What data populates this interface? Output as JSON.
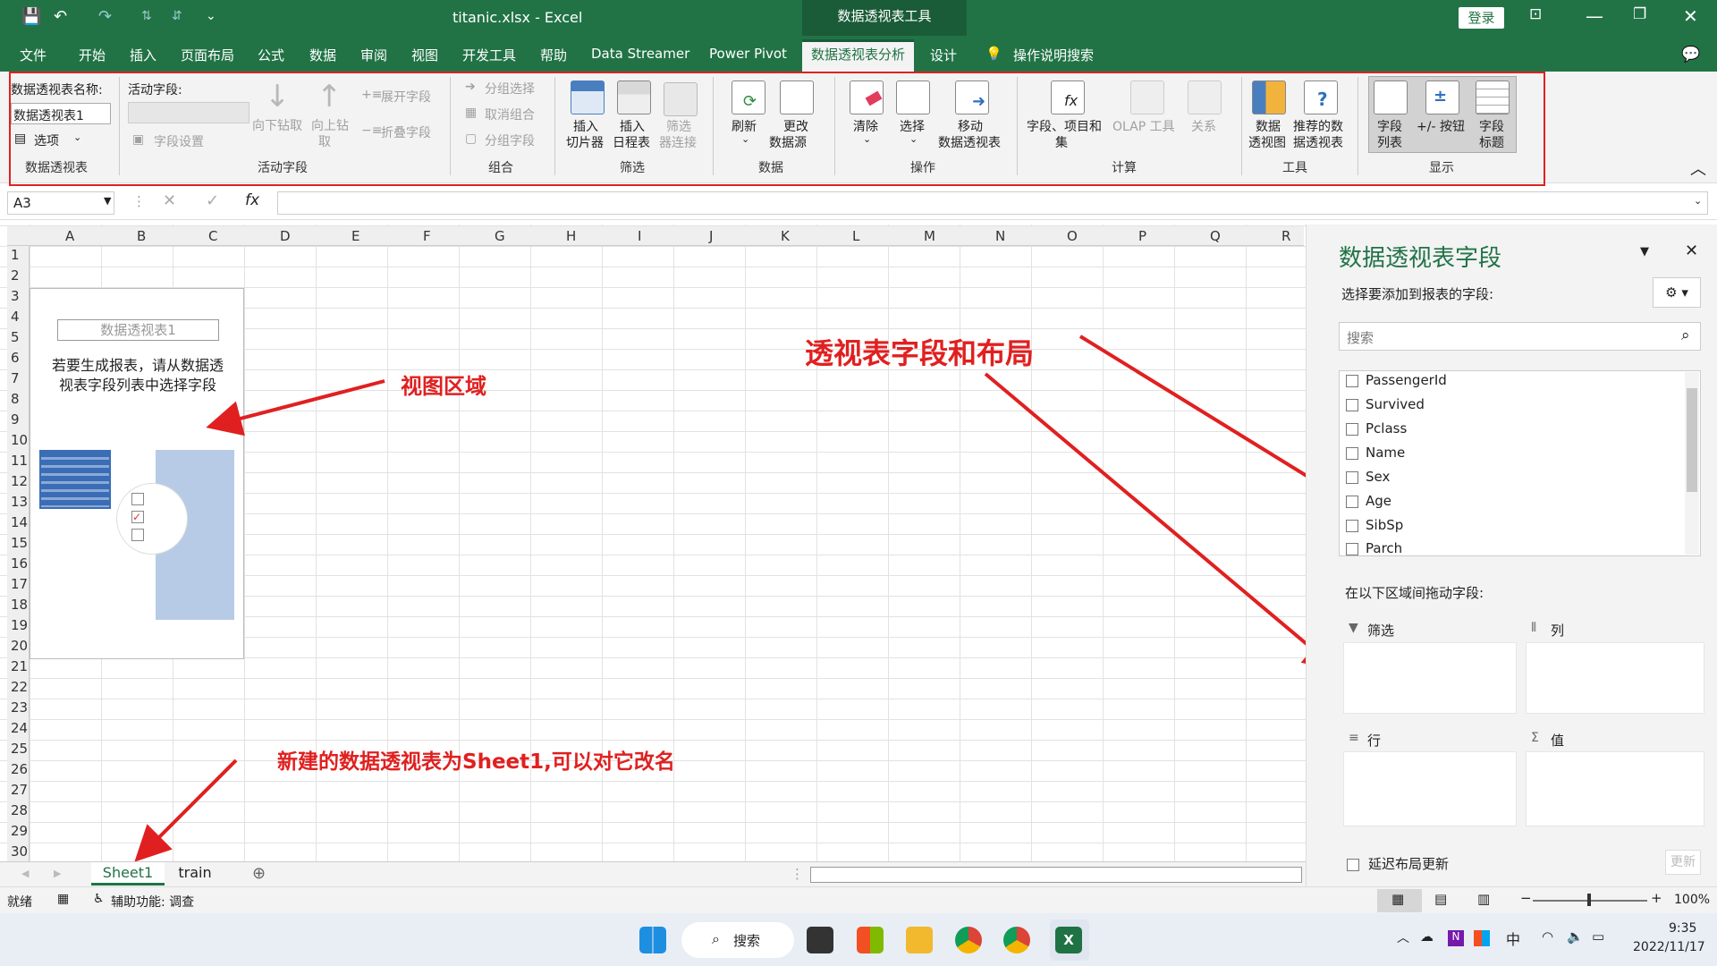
{
  "titlebar": {
    "file_title": "titanic.xlsx  -  Excel",
    "context_title": "数据透视表工具",
    "login": "登录",
    "qa_save": "💾",
    "qa_undo": "↶",
    "qa_redo": "↷"
  },
  "tabs": [
    "文件",
    "开始",
    "插入",
    "页面布局",
    "公式",
    "数据",
    "审阅",
    "视图",
    "开发工具",
    "帮助",
    "Data Streamer",
    "Power Pivot",
    "数据透视表分析",
    "设计"
  ],
  "tell_me": "操作说明搜索",
  "ribbon": {
    "pivot_name_label": "数据透视表名称:",
    "pivot_name_value": "数据透视表1",
    "options": "选项",
    "group_pivot": "数据透视表",
    "active_field_label": "活动字段:",
    "field_settings": "字段设置",
    "drill_down": "向下钻取",
    "drill_up": "向上钻",
    "drill_up2": "取",
    "expand_field": "展开字段",
    "collapse_field": "折叠字段",
    "group_active": "活动字段",
    "group_select": "分组选择",
    "ungroup": "取消组合",
    "group_field": "分组字段",
    "group_group": "组合",
    "insert_slicer_1": "插入",
    "insert_slicer_2": "切片器",
    "insert_timeline_1": "插入",
    "insert_timeline_2": "日程表",
    "filter_conn_1": "筛选",
    "filter_conn_2": "器连接",
    "group_filter": "筛选",
    "refresh": "刷新",
    "change_source_1": "更改",
    "change_source_2": "数据源",
    "group_data": "数据",
    "clear": "清除",
    "select": "选择",
    "move_1": "移动",
    "move_2": "数据透视表",
    "group_ops": "操作",
    "fields_items_1": "字段、项目和",
    "fields_items_2": "集",
    "olap": "OLAP 工具",
    "relations": "关系",
    "group_calc": "计算",
    "pivotchart_1": "数据",
    "pivotchart_2": "透视图",
    "recommended_1": "推荐的数",
    "recommended_2": "据透视表",
    "group_tools": "工具",
    "field_list_1": "字段",
    "field_list_2": "列表",
    "plusminus": "+/- 按钮",
    "field_headers_1": "字段",
    "field_headers_2": "标题",
    "group_show": "显示"
  },
  "formula_bar": {
    "name_box": "A3",
    "fx": "fx",
    "cancel": "✕",
    "enter": "✓"
  },
  "grid": {
    "columns": [
      "A",
      "B",
      "C",
      "D",
      "E",
      "F",
      "G",
      "H",
      "I",
      "J",
      "K",
      "L",
      "M",
      "N",
      "O",
      "P",
      "Q",
      "R"
    ],
    "rows": [
      "1",
      "2",
      "3",
      "4",
      "5",
      "6",
      "7",
      "8",
      "9",
      "10",
      "11",
      "12",
      "13",
      "14",
      "15",
      "16",
      "17",
      "18",
      "19",
      "20",
      "21",
      "22",
      "23",
      "24",
      "25",
      "26",
      "27",
      "28",
      "29",
      "30"
    ]
  },
  "pivot_placeholder": {
    "name": "数据透视表1",
    "help_line1": "若要生成报表，请从数据透",
    "help_line2": "视表字段列表中选择字段"
  },
  "annotations": {
    "view_area": "视图区域",
    "fields_layout": "透视表字段和布局",
    "new_sheet": "新建的数据透视表为Sheet1,可以对它改名"
  },
  "pane": {
    "title": "数据透视表字段",
    "choose_label": "选择要添加到报表的字段:",
    "search_placeholder": "搜索",
    "fields": [
      "PassengerId",
      "Survived",
      "Pclass",
      "Name",
      "Sex",
      "Age",
      "SibSp",
      "Parch"
    ],
    "drag_label": "在以下区域间拖动字段:",
    "area_filter": "筛选",
    "area_columns": "列",
    "area_rows": "行",
    "area_values": "值",
    "defer_update": "延迟布局更新",
    "update_button": "更新"
  },
  "sheets": [
    "Sheet1",
    "train"
  ],
  "status": {
    "ready": "就绪",
    "accessibility": "辅助功能: 调查",
    "zoom": "100%"
  },
  "taskbar": {
    "search": "搜索",
    "time": "9:35",
    "date": "2022/11/17",
    "ime": "中"
  }
}
